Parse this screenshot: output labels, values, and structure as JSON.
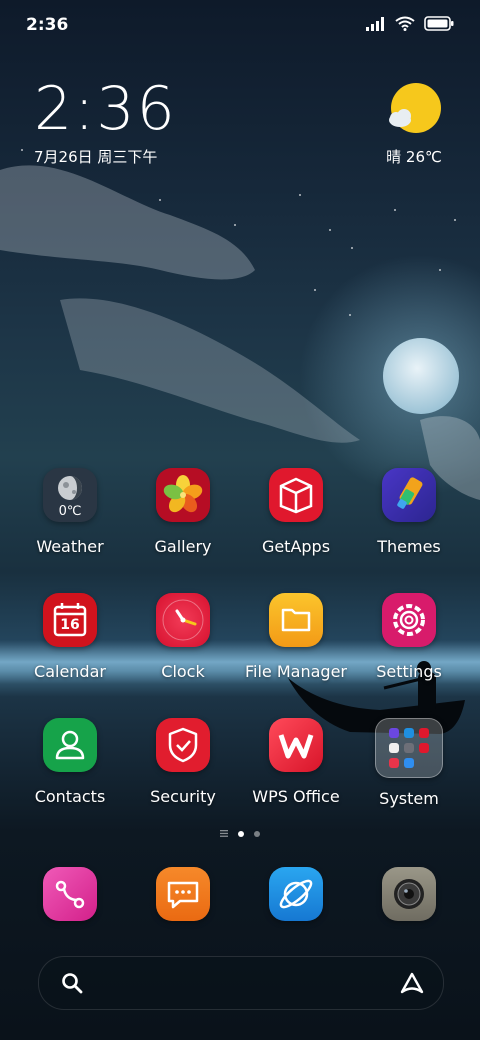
{
  "status": {
    "time": "2:36"
  },
  "clock_widget": {
    "time": "2:36",
    "date": "7月26日 周三下午"
  },
  "weather_widget": {
    "text": "晴 26℃",
    "icon": "sun-cloud-icon"
  },
  "apps": [
    {
      "label": "Weather",
      "icon": "weather-icon",
      "icon_text": "0℃"
    },
    {
      "label": "Gallery",
      "icon": "gallery-icon"
    },
    {
      "label": "GetApps",
      "icon": "getapps-icon"
    },
    {
      "label": "Themes",
      "icon": "themes-icon"
    },
    {
      "label": "Calendar",
      "icon": "calendar-icon",
      "icon_text": "16"
    },
    {
      "label": "Clock",
      "icon": "clock-icon"
    },
    {
      "label": "File Manager",
      "icon": "folder-icon"
    },
    {
      "label": "Settings",
      "icon": "settings-icon"
    },
    {
      "label": "Contacts",
      "icon": "contacts-icon"
    },
    {
      "label": "Security",
      "icon": "security-icon"
    },
    {
      "label": "WPS Office",
      "icon": "wps-icon"
    },
    {
      "label": "System",
      "icon": "system-folder-icon"
    }
  ],
  "dock": [
    {
      "icon": "phone-icon"
    },
    {
      "icon": "messages-icon"
    },
    {
      "icon": "browser-icon"
    },
    {
      "icon": "camera-icon"
    }
  ],
  "pager": {
    "pages": 2,
    "active": 0
  },
  "colors": {
    "gallery": "#c8102e",
    "getapps": "#e0182d",
    "themes": "#3a2fa6",
    "calendar": "#d1131d",
    "clock": "#e2183d",
    "filemanager": "#f6b21b",
    "settings": "#d81b6b",
    "contacts": "#16a34a",
    "security": "#e11d2e",
    "wps": "#ea2b3e",
    "phone": "#e83fa0",
    "messages": "#f07a1a",
    "browser": "#1f8fe0"
  }
}
